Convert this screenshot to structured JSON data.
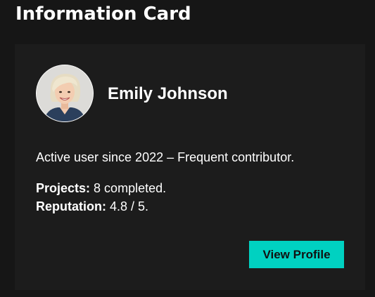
{
  "page": {
    "title": "Information Card"
  },
  "card": {
    "avatar_icon": "user-portrait-photo",
    "name": "Emily Johnson",
    "description": "Active user since 2022 – Frequent contributor.",
    "stats": [
      {
        "label": "Projects:",
        "value": "8 completed."
      },
      {
        "label": "Reputation:",
        "value": "4.8 / 5."
      }
    ],
    "button_label": "View Profile"
  },
  "colors": {
    "page_background": "#161616",
    "card_background": "#1c1c1c",
    "accent": "#00d1c1",
    "text": "#ffffff"
  }
}
